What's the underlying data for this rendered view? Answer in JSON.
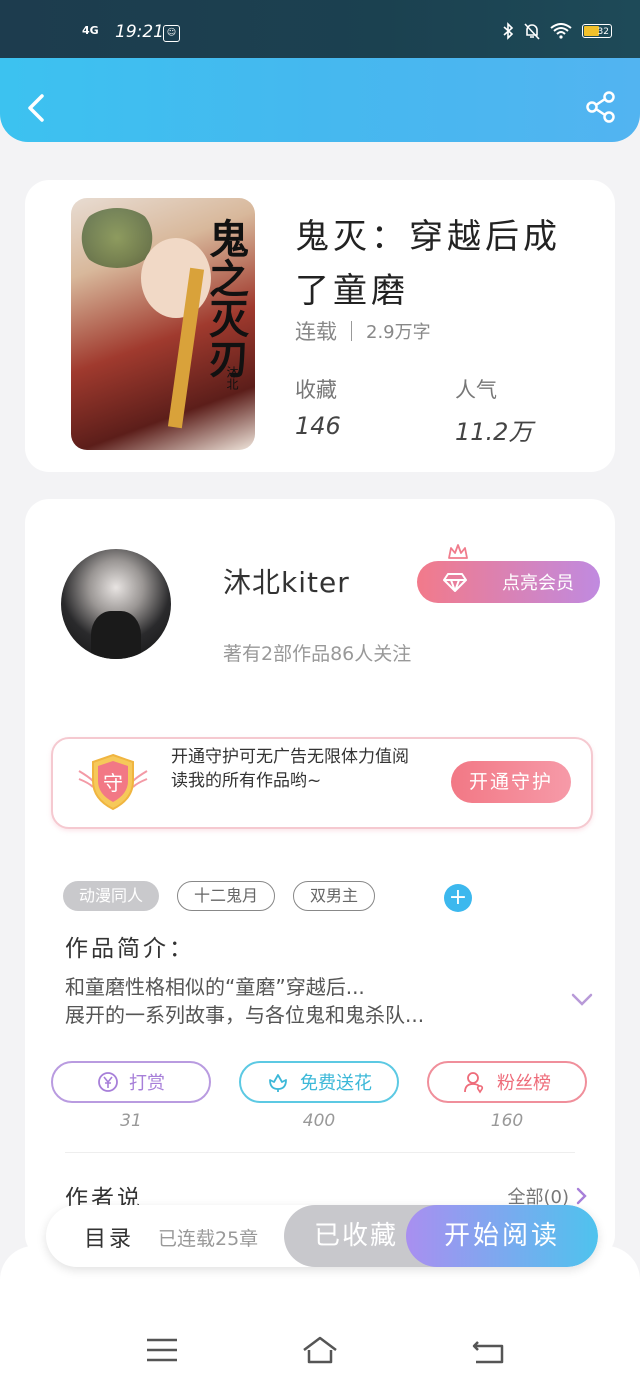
{
  "status_bar": {
    "signal": "4G",
    "time": "19:21",
    "battery": "32"
  },
  "book": {
    "cover_title": "鬼之灭刃",
    "cover_author": "沐北",
    "title": "鬼灭：穿越后成了童磨",
    "status": "连载",
    "word_count": "2.9万字",
    "stats": [
      {
        "label": "收藏",
        "value": "146"
      },
      {
        "label": "人气",
        "value": "11.2万"
      }
    ]
  },
  "author": {
    "name": "沐北kiter",
    "summary": "著有2部作品86人关注",
    "vip_button": "点亮会员"
  },
  "guard": {
    "shield_char": "守",
    "text": "开通守护可无广告无限体力值阅读我的所有作品哟~",
    "button": "开通守护"
  },
  "tags": [
    "动漫同人",
    "十二鬼月",
    "双男主"
  ],
  "intro": {
    "title": "作品简介：",
    "text": "和童磨性格相似的“童磨”穿越后...\n展开的一系列故事，与各位鬼和鬼杀队..."
  },
  "actions": [
    {
      "label": "打赏",
      "count": "31",
      "color": "#a77fd9",
      "icon": "yen-icon"
    },
    {
      "label": "免费送花",
      "count": "400",
      "color": "#3cb8d8",
      "icon": "flower-icon"
    },
    {
      "label": "粉丝榜",
      "count": "160",
      "color": "#ee6c7a",
      "icon": "fan-icon"
    }
  ],
  "author_says": {
    "title": "作者说",
    "all": "全部(0)"
  },
  "reading_bar": {
    "catalog": "目录",
    "chapters": "已连载25章",
    "favorited": "已收藏",
    "start_reading": "开始阅读"
  }
}
